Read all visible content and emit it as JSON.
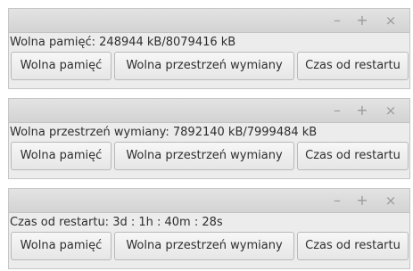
{
  "titlebar": {
    "minimize_glyph": "–",
    "maximize_glyph": "+",
    "close_glyph": "×"
  },
  "windows": [
    {
      "info": "Wolna pamięć: 248944 kB/8079416 kB",
      "buttons": [
        "Wolna pamięć",
        "Wolna przestrzeń wymiany",
        "Czas od restartu"
      ]
    },
    {
      "info": "Wolna przestrzeń wymiany: 7892140 kB/7999484 kB",
      "buttons": [
        "Wolna pamięć",
        "Wolna przestrzeń wymiany",
        "Czas od restartu"
      ]
    },
    {
      "info": "Czas od restartu: 3d : 1h : 40m : 28s",
      "buttons": [
        "Wolna pamięć",
        "Wolna przestrzeń wymiany",
        "Czas od restartu"
      ]
    }
  ]
}
